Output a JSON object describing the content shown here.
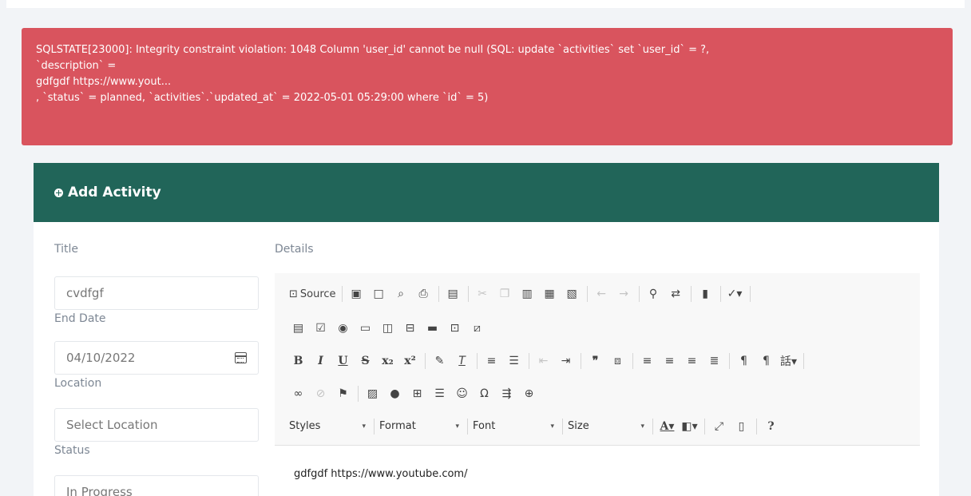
{
  "alert": {
    "lines": [
      "SQLSTATE[23000]: Integrity constraint violation: 1048 Column 'user_id' cannot be null (SQL: update `activities` set `user_id` = ?,",
      "`description` =",
      "gdfgdf https://www.yout...",
      ", `status` = planned, `activities`.`updated_at` = 2022-05-01 05:29:00 where `id` = 5)"
    ]
  },
  "card": {
    "title": "Add Activity"
  },
  "form": {
    "title_label": "Title",
    "title_value": "cvdfgf",
    "end_date_label": "End Date",
    "end_date_value": "04/10/2022",
    "location_label": "Location",
    "location_value": "Select Location",
    "status_label": "Status",
    "status_value": "In Progress",
    "details_label": "Details"
  },
  "editor": {
    "source_label": "Source",
    "combos": {
      "styles": "Styles",
      "format": "Format",
      "font": "Font",
      "size": "Size"
    },
    "content": "gdfgdf https://www.youtube.com/",
    "icons": {
      "row1": [
        "save-icon",
        "new-page-icon",
        "preview-icon",
        "print-icon",
        "templates-icon",
        "cut-icon",
        "copy-icon",
        "paste-icon",
        "paste-text-icon",
        "paste-word-icon",
        "undo-icon",
        "redo-icon",
        "find-icon",
        "replace-icon",
        "select-all-icon",
        "spellcheck-icon"
      ],
      "row2": [
        "form-icon",
        "checkbox-icon",
        "radio-icon",
        "textfield-icon",
        "textarea-icon",
        "select-icon",
        "button-icon",
        "image-button-icon",
        "hidden-field-icon"
      ],
      "row3": [
        "bold-icon",
        "italic-icon",
        "underline-icon",
        "strike-icon",
        "subscript-icon",
        "superscript-icon",
        "copy-format-icon",
        "remove-format-icon",
        "numbered-list-icon",
        "bulleted-list-icon",
        "outdent-icon",
        "indent-icon",
        "blockquote-icon",
        "div-icon",
        "align-left-icon",
        "align-center-icon",
        "align-right-icon",
        "justify-icon",
        "ltr-icon",
        "rtl-icon",
        "language-icon"
      ],
      "row4": [
        "link-icon",
        "unlink-icon",
        "anchor-icon",
        "image-icon",
        "flash-icon",
        "table-icon",
        "horizontal-line-icon",
        "smiley-icon",
        "special-char-icon",
        "page-break-icon",
        "iframe-icon"
      ],
      "row5": [
        "text-color-icon",
        "bg-color-icon",
        "maximize-icon",
        "show-blocks-icon",
        "help-icon"
      ]
    }
  },
  "colors": {
    "alert_bg": "#d9545e",
    "header_bg": "#216559"
  }
}
